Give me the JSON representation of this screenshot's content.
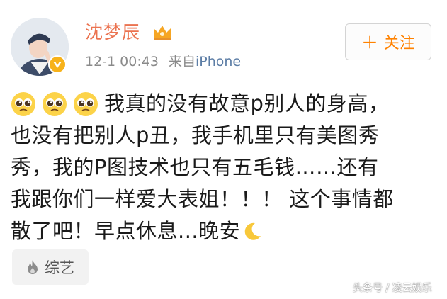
{
  "post": {
    "username": "沈梦辰",
    "timestamp": "12-1 00:43",
    "source_prefix": "来自",
    "source_device": "iPhone",
    "follow_label": "关注",
    "lines": [
      "我真的没有故意p别人的身高，",
      "也没有把别人p丑，我手机里只有美图秀",
      "秀，我的P图技术也只有五毛钱……还有",
      "我跟你们一样爱大表姐！！！ 这个事情都",
      "散了吧！早点休息...晚安"
    ],
    "tag_label": "综艺"
  },
  "watermark": "头条号 / 凌云娱乐",
  "icons": {
    "emoji": "pleading-face-icon",
    "moon": "crescent-moon-icon",
    "crown": "crown-icon",
    "verified": "verified-badge-icon",
    "fire": "flame-icon",
    "plus": "plus-icon"
  },
  "colors": {
    "username": "#eb7350",
    "follow": "#ff8200",
    "device_link": "#5d7ea6",
    "verified": "#f7b21a"
  }
}
